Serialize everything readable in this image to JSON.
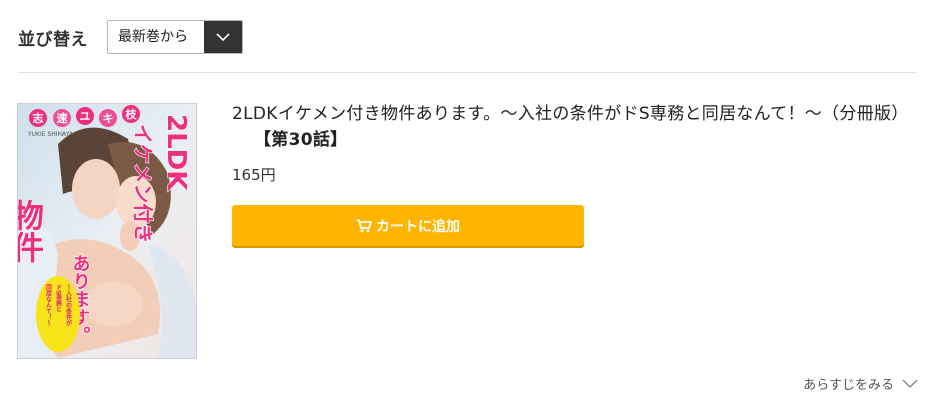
{
  "sort": {
    "label": "並び替え",
    "selected": "最新巻から"
  },
  "item": {
    "title": "2LDKイケメン付き物件あります。～入社の条件がドS専務と同居なんて！～（分冊版）",
    "volume": "【第30話】",
    "price": "165円",
    "cart_label": "カートに追加",
    "accent_color": "#ffb400",
    "cover": {
      "author_chars": [
        "志",
        "速",
        "ユ",
        "キ",
        "枝"
      ],
      "author_roman": "YUKIE SHIHAYA",
      "title_line1": "2LDK",
      "title_line2": "イケメン付き",
      "title_line3": "物件",
      "title_line4": "あります。",
      "bubble_lines": [
        "～入社の条件が",
        "ドS専務と",
        "同居なんて！～"
      ]
    }
  },
  "synopsis_label": "あらすじをみる",
  "icons": {
    "sort_toggle": "chevron-down-icon",
    "cart": "cart-icon",
    "synopsis": "chevron-down-icon"
  }
}
